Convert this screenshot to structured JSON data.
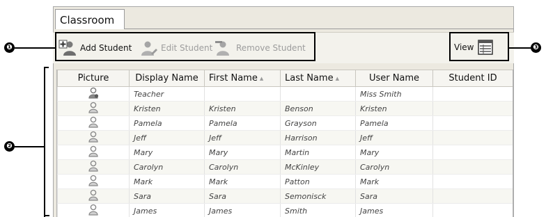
{
  "tab": {
    "label": "Classroom"
  },
  "toolbar": {
    "add_label": "Add Student",
    "edit_label": "Edit Student",
    "remove_label": "Remove Student",
    "view_label": "View"
  },
  "callouts": [
    "❶",
    "❷",
    "❸"
  ],
  "table": {
    "columns": [
      "Picture",
      "Display Name",
      "First Name",
      "Last Name",
      "User Name",
      "Student ID"
    ],
    "rows": [
      {
        "picture": "teacher-icon",
        "display": "Teacher",
        "first": "",
        "last": "",
        "user": "Miss Smith",
        "id": ""
      },
      {
        "picture": "student-icon",
        "display": "Kristen",
        "first": "Kristen",
        "last": "Benson",
        "user": "Kristen",
        "id": ""
      },
      {
        "picture": "student-icon",
        "display": "Pamela",
        "first": "Pamela",
        "last": "Grayson",
        "user": "Pamela",
        "id": ""
      },
      {
        "picture": "student-icon",
        "display": "Jeff",
        "first": "Jeff",
        "last": "Harrison",
        "user": "Jeff",
        "id": ""
      },
      {
        "picture": "student-icon",
        "display": "Mary",
        "first": "Mary",
        "last": "Martin",
        "user": "Mary",
        "id": ""
      },
      {
        "picture": "student-icon",
        "display": "Carolyn",
        "first": "Carolyn",
        "last": "McKinley",
        "user": "Carolyn",
        "id": ""
      },
      {
        "picture": "student-icon",
        "display": "Mark",
        "first": "Mark",
        "last": "Patton",
        "user": "Mark",
        "id": ""
      },
      {
        "picture": "student-icon",
        "display": "Sara",
        "first": "Sara",
        "last": "Semonisck",
        "user": "Sara",
        "id": ""
      },
      {
        "picture": "student-icon",
        "display": "James",
        "first": "James",
        "last": "Smith",
        "user": "James",
        "id": ""
      }
    ]
  }
}
